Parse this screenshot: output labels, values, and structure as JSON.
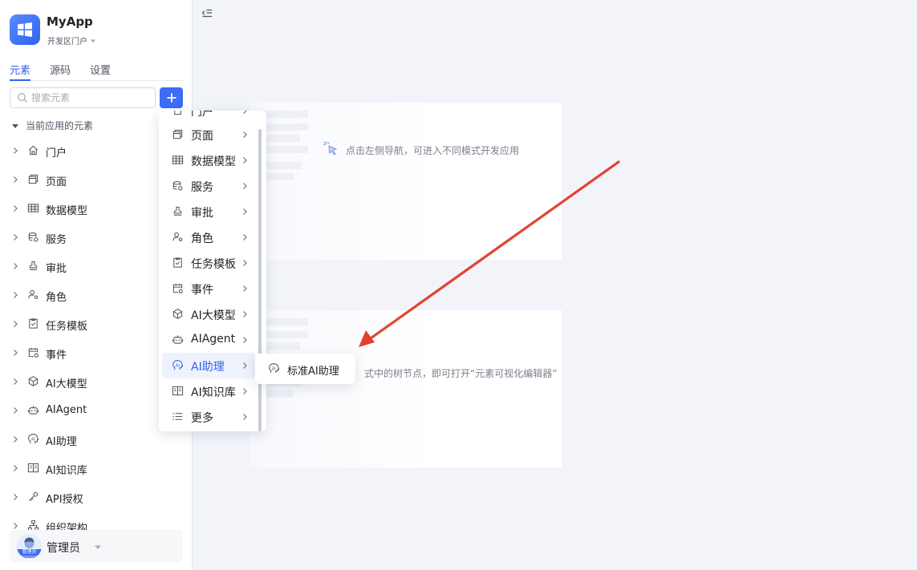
{
  "app": {
    "name": "MyApp",
    "portal": "开发区门户"
  },
  "tabs": [
    {
      "label": "元素",
      "active": true
    },
    {
      "label": "源码",
      "active": false
    },
    {
      "label": "设置",
      "active": false
    }
  ],
  "search": {
    "placeholder": "搜索元素",
    "value": ""
  },
  "group_title": "当前应用的元素",
  "tree_items": [
    {
      "label": "门户",
      "icon": "home-icon"
    },
    {
      "label": "页面",
      "icon": "page-icon"
    },
    {
      "label": "数据模型",
      "icon": "table-icon"
    },
    {
      "label": "服务",
      "icon": "database-icon"
    },
    {
      "label": "审批",
      "icon": "stamp-icon"
    },
    {
      "label": "角色",
      "icon": "role-icon"
    },
    {
      "label": "任务模板",
      "icon": "clipboard-check-icon"
    },
    {
      "label": "事件",
      "icon": "calendar-event-icon"
    },
    {
      "label": "AI大模型",
      "icon": "cube-icon"
    },
    {
      "label": "AIAgent",
      "icon": "robot-icon"
    },
    {
      "label": "AI助理",
      "icon": "ai-assistant-icon"
    },
    {
      "label": "AI知识库",
      "icon": "book-icon"
    },
    {
      "label": "API授权",
      "icon": "key-icon"
    },
    {
      "label": "组织架构",
      "icon": "org-chart-icon"
    }
  ],
  "user": {
    "name": "管理员",
    "avatar_tag": "管理员"
  },
  "menu": {
    "partial_label": "门户",
    "items": [
      {
        "label": "页面",
        "icon": "page-icon",
        "active": false
      },
      {
        "label": "数据模型",
        "icon": "table-icon",
        "active": false
      },
      {
        "label": "服务",
        "icon": "database-icon",
        "active": false
      },
      {
        "label": "审批",
        "icon": "stamp-icon",
        "active": false
      },
      {
        "label": "角色",
        "icon": "role-icon",
        "active": false
      },
      {
        "label": "任务模板",
        "icon": "clipboard-check-icon",
        "active": false
      },
      {
        "label": "事件",
        "icon": "calendar-event-icon",
        "active": false
      },
      {
        "label": "AI大模型",
        "icon": "cube-icon",
        "active": false
      },
      {
        "label": "AIAgent",
        "icon": "robot-icon",
        "active": false
      },
      {
        "label": "AI助理",
        "icon": "ai-assistant-icon",
        "active": true
      },
      {
        "label": "AI知识库",
        "icon": "book-icon",
        "active": false
      },
      {
        "label": "更多",
        "icon": "list-icon",
        "active": false
      }
    ]
  },
  "submenu": {
    "label": "标准AI助理",
    "icon": "ai-assistant-icon"
  },
  "main": {
    "hint_top": "点击左侧导航，可进入不同模式开发应用",
    "hint_bottom": "式中的树节点，即可打开“元素可视化编辑器”"
  },
  "colors": {
    "accent": "#2f63f0",
    "annotation_arrow": "#e2432f"
  }
}
